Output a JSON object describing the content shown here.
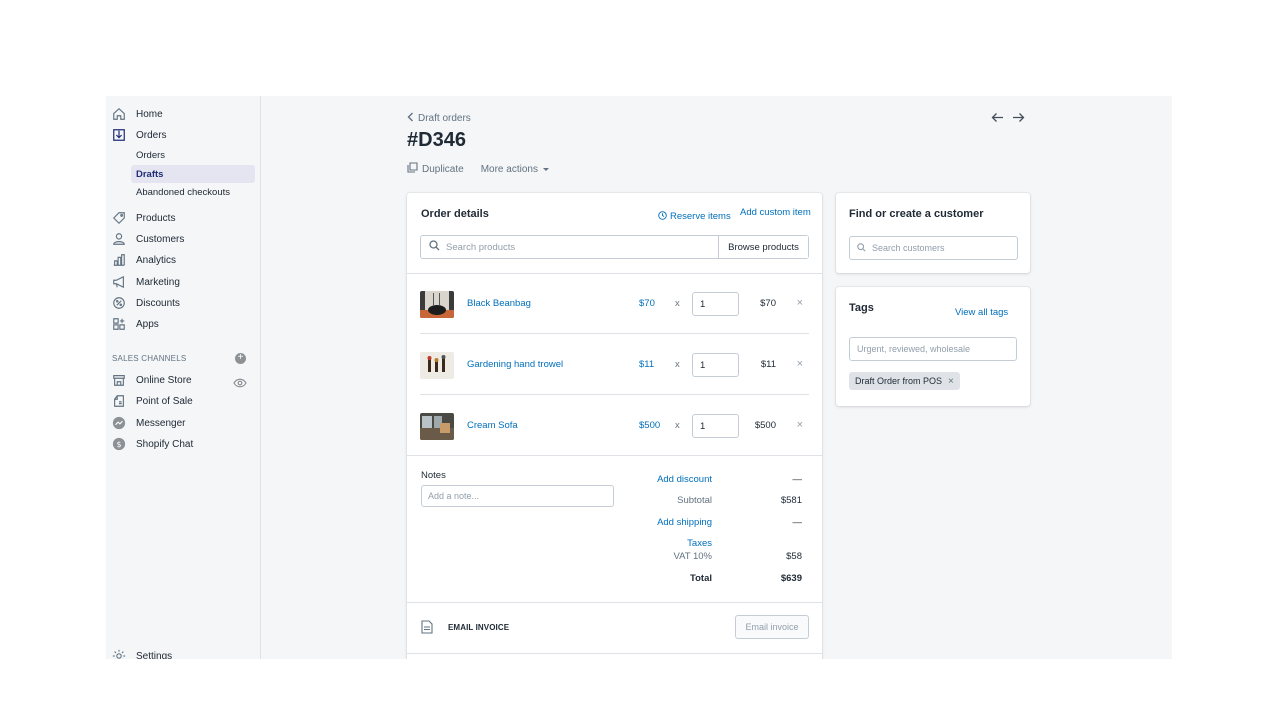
{
  "sidebar": {
    "home": "Home",
    "orders": "Orders",
    "orders_sub": [
      "Orders",
      "Drafts",
      "Abandoned checkouts"
    ],
    "products": "Products",
    "customers": "Customers",
    "analytics": "Analytics",
    "marketing": "Marketing",
    "discounts": "Discounts",
    "apps": "Apps",
    "sales_channels_label": "SALES CHANNELS",
    "channels": [
      "Online Store",
      "Point of Sale",
      "Messenger",
      "Shopify Chat"
    ],
    "settings": "Settings"
  },
  "header": {
    "breadcrumb": "Draft orders",
    "title": "#D346",
    "duplicate": "Duplicate",
    "more_actions": "More actions"
  },
  "order": {
    "title": "Order details",
    "reserve_items": "Reserve items",
    "add_custom_item": "Add custom item",
    "search_placeholder": "Search products",
    "browse_products": "Browse products",
    "items": [
      {
        "name": "Black Beanbag",
        "price": "$70",
        "x": "x",
        "qty": "1",
        "total": "$70"
      },
      {
        "name": "Gardening hand trowel",
        "price": "$11",
        "x": "x",
        "qty": "1",
        "total": "$11"
      },
      {
        "name": "Cream Sofa",
        "price": "$500",
        "x": "x",
        "qty": "1",
        "total": "$500"
      }
    ],
    "remove_glyph": "×",
    "notes_label": "Notes",
    "notes_placeholder": "Add a note...",
    "summary": {
      "add_discount": "Add discount",
      "discount_value": "—",
      "subtotal_label": "Subtotal",
      "subtotal_value": "$581",
      "add_shipping": "Add shipping",
      "shipping_value": "—",
      "taxes_label": "Taxes",
      "vat_label": "VAT 10%",
      "vat_value": "$58",
      "total_label": "Total",
      "total_value": "$639"
    },
    "email_invoice_label": "EMAIL INVOICE",
    "email_invoice_button": "Email invoice"
  },
  "customer": {
    "title": "Find or create a customer",
    "search_placeholder": "Search customers"
  },
  "tags": {
    "title": "Tags",
    "view_all": "View all tags",
    "input_placeholder": "Urgent, reviewed, wholesale",
    "chip": "Draft Order from POS",
    "chip_remove": "×"
  },
  "colors": {
    "link": "#006fbb",
    "sidebar_bg": "#f4f6f8",
    "active_nav_bg": "#e4e5f0",
    "active_nav_text": "#202e78"
  }
}
